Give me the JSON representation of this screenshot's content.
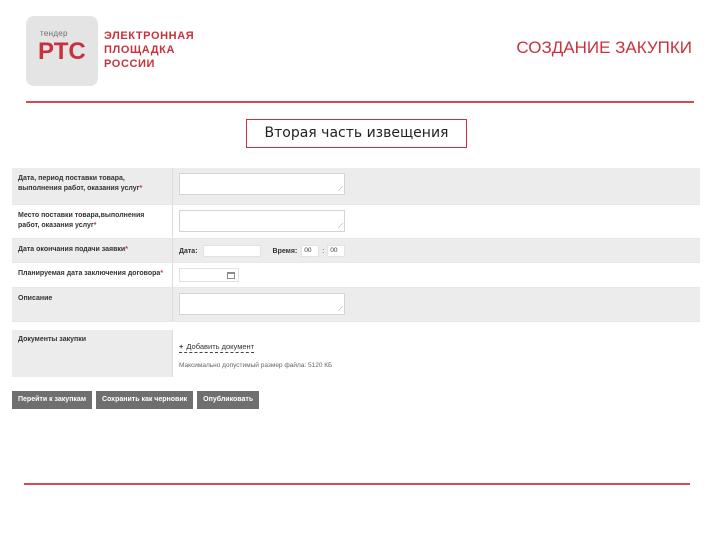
{
  "brand": {
    "logo_small": "тендер",
    "logo_big": "РТС",
    "lines": [
      "ЭЛЕКТРОННАЯ",
      "ПЛОЩАДКА",
      "РОССИИ"
    ],
    "accent_color": "#c8323c"
  },
  "header": {
    "title": "СОЗДАНИЕ ЗАКУПКИ"
  },
  "section": {
    "caption": "Вторая часть извещения"
  },
  "form": {
    "rows": [
      {
        "label": "Дата, период поставки товара, выполнения работ, оказания услуг",
        "required": "*",
        "value": ""
      },
      {
        "label": "Место поставки товара,выполнения работ, оказания услуг",
        "required": "*",
        "value": ""
      },
      {
        "label": "Дата окончания подачи заявки",
        "required": "*",
        "date_label": "Дата:",
        "date_value": "",
        "time_label": "Время:",
        "hours": "00",
        "colon": ":",
        "minutes": "00"
      },
      {
        "label": "Планируемая дата заключения договора",
        "required": "*",
        "value": "",
        "icon": "calendar-icon"
      },
      {
        "label": "Описание",
        "required": "",
        "value": ""
      }
    ]
  },
  "documents": {
    "label": "Документы закупки",
    "add_icon": "plus-icon",
    "add_link": "Добавить документ",
    "hint": "Максимально допустимый размер файла: 5120 КБ"
  },
  "buttons": {
    "go_to_purchases": "Перейти к закупкам",
    "save_draft": "Сохранить как черновик",
    "publish": "Опубликовать",
    "color": "#6f6f6f"
  }
}
